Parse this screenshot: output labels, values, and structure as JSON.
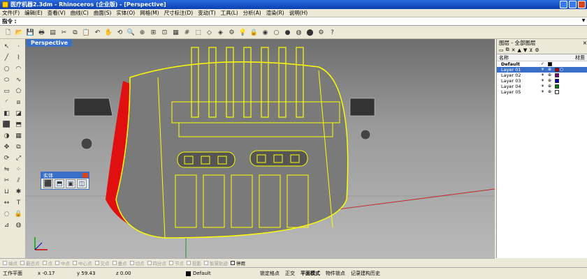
{
  "window": {
    "title": "医疗机器2.3dm - Rhinoceros (企业版) - [Perspective]"
  },
  "menu": [
    "文件(F)",
    "编辑(E)",
    "查看(V)",
    "曲线(C)",
    "曲面(S)",
    "实体(O)",
    "网格(M)",
    "尺寸标注(D)",
    "变动(T)",
    "工具(L)",
    "分析(A)",
    "渲染(R)",
    "说明(H)"
  ],
  "command": {
    "label": "指令 :",
    "value": ""
  },
  "viewport": {
    "name": "Perspective"
  },
  "float_palette": {
    "title": "实体"
  },
  "layers_panel": {
    "title": "图层 - 全部图层",
    "col_name": "名称",
    "col_material": "材质",
    "layers": [
      {
        "name": "Default",
        "current": "✓",
        "color": "#000000"
      },
      {
        "name": "Layer 01",
        "current": "",
        "color": "#c00000"
      },
      {
        "name": "Layer 02",
        "current": "",
        "color": "#800080"
      },
      {
        "name": "Layer 03",
        "current": "",
        "color": "#0000c0"
      },
      {
        "name": "Layer 04",
        "current": "",
        "color": "#008000"
      },
      {
        "name": "Layer 05",
        "current": "",
        "color": "#ffffff"
      }
    ]
  },
  "osnap": [
    {
      "label": "端点",
      "on": false
    },
    {
      "label": "最近点",
      "on": false
    },
    {
      "label": "点",
      "on": false
    },
    {
      "label": "中点",
      "on": false
    },
    {
      "label": "中心点",
      "on": false
    },
    {
      "label": "交点",
      "on": false
    },
    {
      "label": "垂点",
      "on": false
    },
    {
      "label": "切点",
      "on": false
    },
    {
      "label": "四分点",
      "on": false
    },
    {
      "label": "节点",
      "on": false
    },
    {
      "label": "投影",
      "on": false
    },
    {
      "label": "智慧轨迹",
      "on": false
    },
    {
      "label": "停用",
      "on": true
    }
  ],
  "status": {
    "cplane": "工作平面",
    "x": "x -0.17",
    "y": "y 59.43",
    "z": "z 0.00",
    "layer": "Default",
    "grid_snap": "锁定格点",
    "ortho": "正交",
    "planar": "平面模式",
    "osnap": "物件锁点",
    "history": "记录建构历史"
  }
}
